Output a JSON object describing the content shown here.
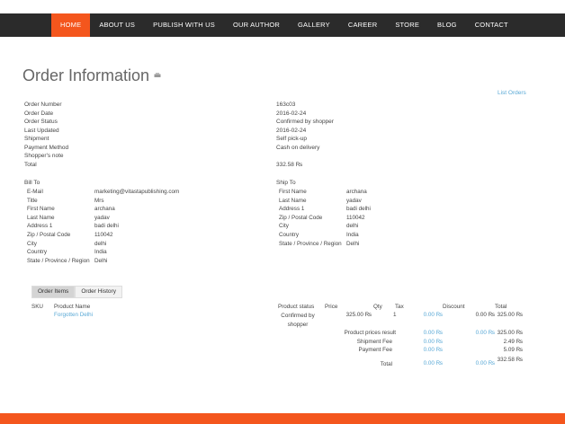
{
  "nav": [
    "HOME",
    "ABOUT US",
    "PUBLISH WITH US",
    "OUR AUTHOR",
    "GALLERY",
    "CAREER",
    "STORE",
    "BLOG",
    "CONTACT"
  ],
  "page_title": "Order Information",
  "list_orders": "List Orders",
  "order": {
    "labels": [
      "Order Number",
      "Order Date",
      "Order Status",
      "Last Updated",
      "Shipment",
      "Payment Method",
      "Shopper's note",
      "Total"
    ],
    "values": [
      "163c03",
      "2016-02-24",
      "Confirmed by shopper",
      "2016-02-24",
      "Self pick-up",
      "Cash on delivery",
      "",
      "332.58 ₨"
    ]
  },
  "bill_to": {
    "heading": "Bill To",
    "rows": [
      [
        "E-Mail",
        "marketing@vitastapublishing.com"
      ],
      [
        "Title",
        "Mrs"
      ],
      [
        "First Name",
        "archana"
      ],
      [
        "Last Name",
        "yadav"
      ],
      [
        "Address 1",
        "badi delhi"
      ],
      [
        "Zip / Postal Code",
        "110042"
      ],
      [
        "City",
        "delhi"
      ],
      [
        "Country",
        "India"
      ],
      [
        "State / Province / Region",
        "Delhi"
      ]
    ]
  },
  "ship_to": {
    "heading": "Ship To",
    "rows": [
      [
        "First Name",
        "archana"
      ],
      [
        "Last Name",
        "yadav"
      ],
      [
        "Address 1",
        "badi delhi"
      ],
      [
        "Zip / Postal Code",
        "110042"
      ],
      [
        "City",
        "delhi"
      ],
      [
        "Country",
        "India"
      ],
      [
        "State / Province / Region",
        "Delhi"
      ]
    ]
  },
  "tabs": [
    "Order Items",
    "Order History"
  ],
  "items": {
    "headers": {
      "sku": "SKU",
      "name": "Product Name",
      "status": "Product status",
      "price": "Price",
      "qty": "Qty",
      "tax": "Tax",
      "discount": "Discount",
      "total": "Total"
    },
    "row": {
      "name": "Forgotten Delhi",
      "status": "Confirmed by shopper",
      "price": "325.00 ₨",
      "qty": "1",
      "tax": "0.00 ₨",
      "discount": "0.00 ₨",
      "total": "325.00 ₨"
    },
    "summary": {
      "prices_label": "Product prices result",
      "prices_tax": "0.00 ₨",
      "prices_discount": "0.00 ₨",
      "prices_total": "325.00 ₨",
      "shipment_label": "Shipment Fee",
      "shipment_tax": "0.00 ₨",
      "shipment_total": "2.49 ₨",
      "payment_label": "Payment Fee",
      "payment_tax": "0.00 ₨",
      "payment_total": "5.09 ₨",
      "total_label": "Total",
      "total_tax": "0.00 ₨",
      "total_discount": "0.00 ₨",
      "total_total": "332.58 ₨"
    }
  }
}
